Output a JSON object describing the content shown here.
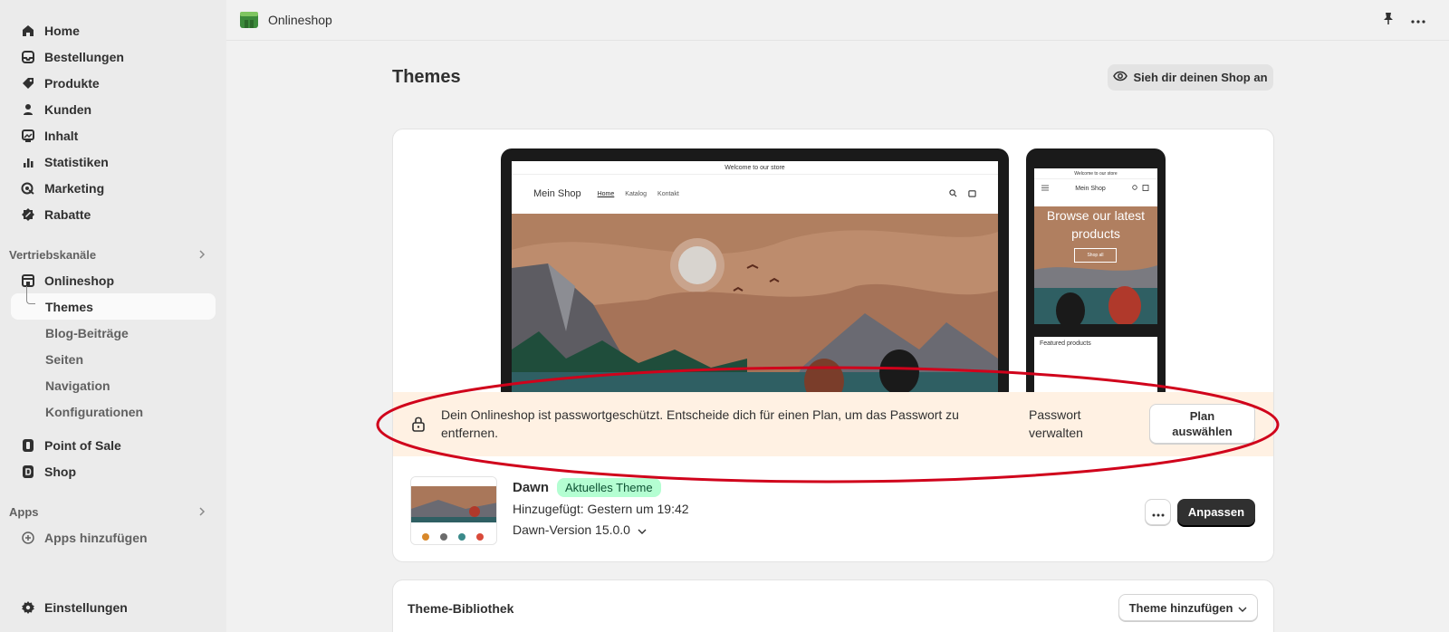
{
  "sidebar": {
    "main_items": [
      {
        "label": "Home",
        "icon": "home-icon"
      },
      {
        "label": "Bestellungen",
        "icon": "inbox-icon"
      },
      {
        "label": "Produkte",
        "icon": "tag-icon"
      },
      {
        "label": "Kunden",
        "icon": "person-icon"
      },
      {
        "label": "Inhalt",
        "icon": "image-icon"
      },
      {
        "label": "Statistiken",
        "icon": "bar-chart-icon"
      },
      {
        "label": "Marketing",
        "icon": "target-icon"
      },
      {
        "label": "Rabatte",
        "icon": "discount-icon"
      }
    ],
    "sales_channels_heading": "Vertriebskanäle",
    "onlineshop_label": "Onlineshop",
    "sub_items": [
      "Themes",
      "Blog-Beiträge",
      "Seiten",
      "Navigation",
      "Konfigurationen"
    ],
    "pos_label": "Point of Sale",
    "shop_label": "Shop",
    "apps_heading": "Apps",
    "add_apps_label": "Apps hinzufügen",
    "settings_label": "Einstellungen"
  },
  "topbar": {
    "app_name": "Onlineshop"
  },
  "page": {
    "title": "Themes",
    "view_shop_label": "Sieh dir deinen Shop an"
  },
  "preview": {
    "announcement": "Welcome to our store",
    "brand": "Mein Shop",
    "nav_links": [
      "Home",
      "Katalog",
      "Kontakt"
    ],
    "phone_hero_text": "Browse our latest products",
    "phone_hero_button": "Shop all",
    "phone_featured": "Featured products"
  },
  "banner": {
    "message": "Dein Onlineshop ist passwortgeschützt. Entscheide dich für einen Plan, um das Passwort zu entfernen.",
    "manage_password": "Passwort verwalten",
    "plan_button_line1": "Plan",
    "plan_button_line2": "auswählen"
  },
  "theme": {
    "name": "Dawn",
    "badge": "Aktuelles Theme",
    "added": "Hinzugefügt: Gestern um 19:42",
    "version": "Dawn-Version 15.0.0",
    "customize_label": "Anpassen"
  },
  "library": {
    "title": "Theme-Bibliothek",
    "add_theme_label": "Theme hinzufügen"
  },
  "colors": {
    "banner_bg": "#fff1e3",
    "badge_bg": "#b4fed2",
    "primary_button": "#303030",
    "annotation": "#d0021b"
  }
}
